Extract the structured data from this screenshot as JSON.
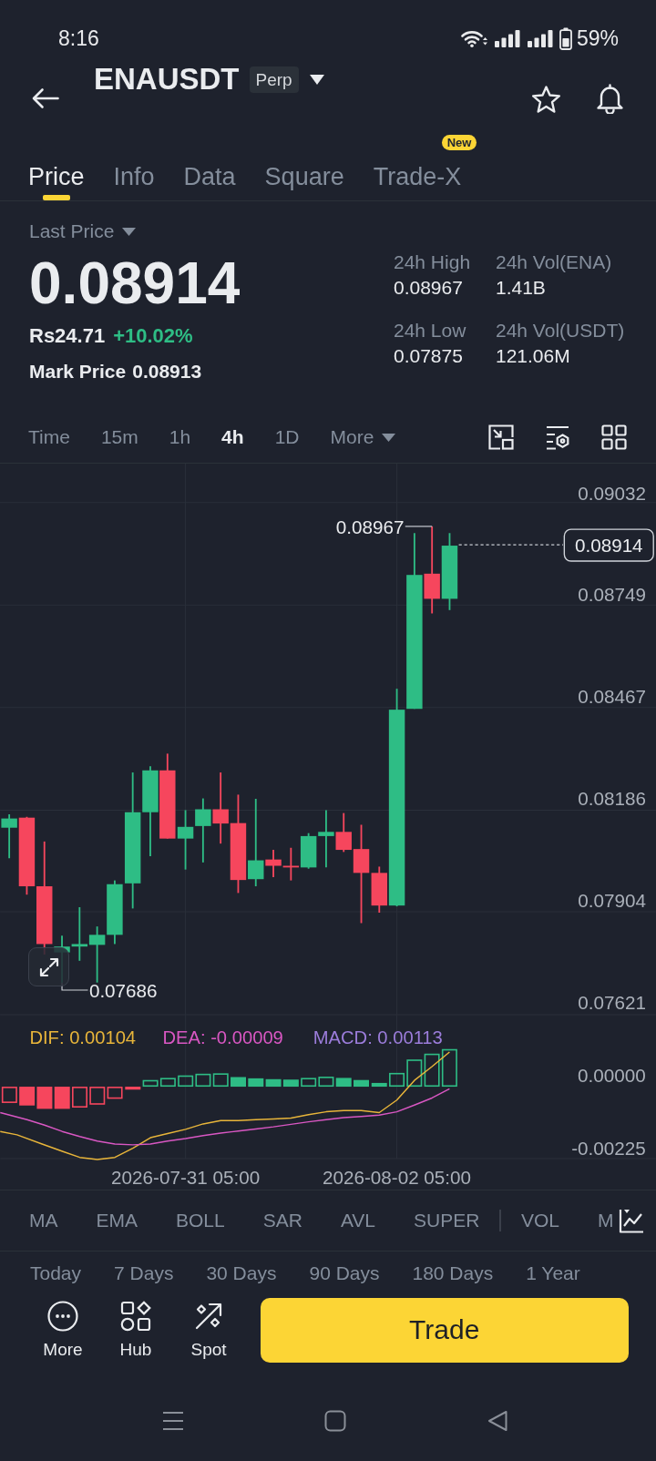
{
  "status_bar": {
    "time": "8:16",
    "battery": "59%"
  },
  "header": {
    "symbol": "ENAUSDT",
    "contract_badge": "Perp"
  },
  "tabs": [
    {
      "label": "Price",
      "selected": true
    },
    {
      "label": "Info",
      "selected": false
    },
    {
      "label": "Data",
      "selected": false
    },
    {
      "label": "Square",
      "selected": false
    },
    {
      "label": "Trade-X",
      "selected": false,
      "badge": "New"
    }
  ],
  "price_panel": {
    "last_price_label": "Last Price",
    "last_price": "0.08914",
    "fiat_price": "Rs24.71",
    "change": "+10.02%",
    "mark_price_label": "Mark Price",
    "mark_price": "0.08913"
  },
  "stats": [
    {
      "label": "24h High",
      "value": "0.08967"
    },
    {
      "label": "24h Vol(ENA)",
      "value": "1.41B"
    },
    {
      "label": "24h Low",
      "value": "0.07875"
    },
    {
      "label": "24h Vol(USDT)",
      "value": "121.06M"
    }
  ],
  "intervals": [
    {
      "label": "Time",
      "kind": "option",
      "selected": false
    },
    {
      "label": "15m",
      "kind": "option",
      "selected": false
    },
    {
      "label": "1h",
      "kind": "option",
      "selected": false
    },
    {
      "label": "4h",
      "kind": "option",
      "selected": true
    },
    {
      "label": "1D",
      "kind": "option",
      "selected": false
    },
    {
      "label": "More",
      "kind": "menu",
      "selected": false
    }
  ],
  "chart": {
    "y_axis_labels": [
      "0.09032",
      "0.08749",
      "0.08467",
      "0.08186",
      "0.07904",
      "0.07621"
    ],
    "high_label": "0.08967",
    "low_label": "0.07686",
    "last_price_tag": "0.08914"
  },
  "macd": {
    "legend": [
      {
        "label": "DIF: 0.00104",
        "color": "#e8b53a"
      },
      {
        "label": "DEA: -0.00009",
        "color": "#d957c3"
      },
      {
        "label": "MACD: 0.00113",
        "color": "#9c7ddb"
      }
    ],
    "y_axis_labels": [
      "0.00000",
      "-0.00225"
    ],
    "time_labels": [
      "2026-07-31 05:00",
      "2026-08-02 05:00"
    ]
  },
  "indicators": {
    "main": [
      "MA",
      "EMA",
      "BOLL",
      "SAR",
      "AVL",
      "SUPER"
    ],
    "sub": [
      "VOL",
      "M"
    ]
  },
  "periods": [
    "Today",
    "7 Days",
    "30 Days",
    "90 Days",
    "180 Days",
    "1 Year"
  ],
  "bottom_bar": {
    "actions": [
      {
        "label": "More",
        "kind": "more"
      },
      {
        "label": "Hub",
        "kind": "hub"
      },
      {
        "label": "Spot",
        "kind": "spot"
      }
    ],
    "trade_button": "Trade"
  }
}
